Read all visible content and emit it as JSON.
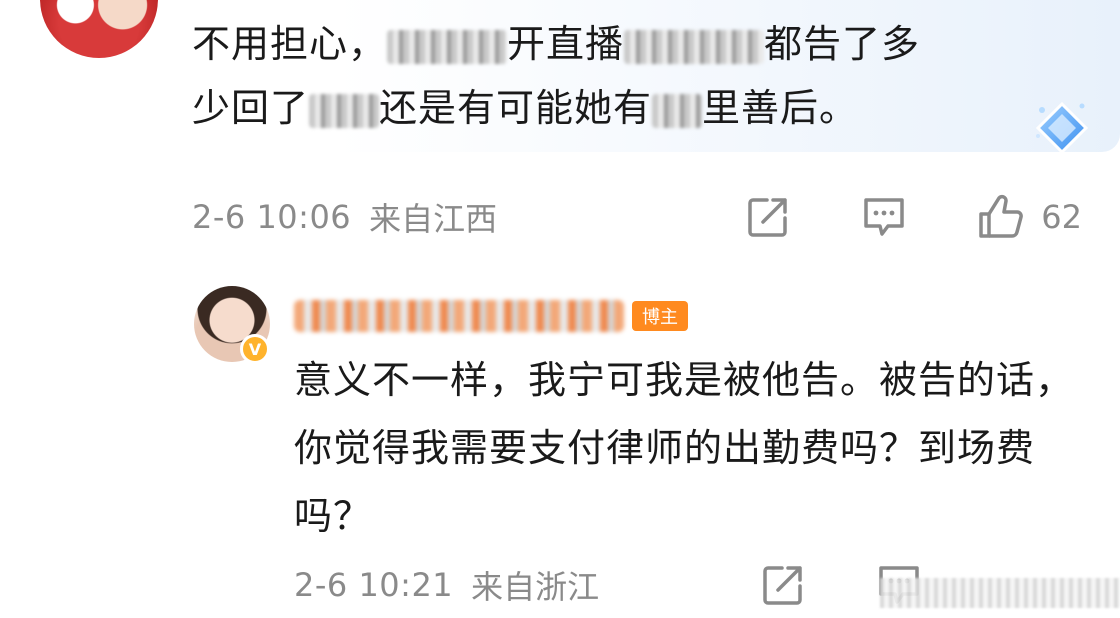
{
  "comment": {
    "text_line1": "不用担心，",
    "text_line1_tail": "开直播",
    "text_line1_end": "都告了多",
    "text_line2_start": "少回了",
    "text_line2_mid": "还是有可能她有",
    "text_line2_end": "里善后。",
    "time": "2-6 10:06",
    "location": "来自江西",
    "like_count": "62"
  },
  "reply": {
    "blogger_tag": "博主",
    "text": "意义不一样，我宁可我是被他告。被告的话，你觉得我需要支付律师的出勤费吗？到场费吗？",
    "time": "2-6 10:21",
    "location": "来自浙江"
  },
  "icons": {
    "share": "share-icon",
    "comment": "comment-icon",
    "like": "thumbs-up-icon",
    "badge": "diamond-badge-icon",
    "verified": "verified-v-icon"
  },
  "colors": {
    "meta_gray": "#8a8a8a",
    "blogger_orange": "#ff8a1f",
    "verified_gold": "#ffb32c"
  }
}
